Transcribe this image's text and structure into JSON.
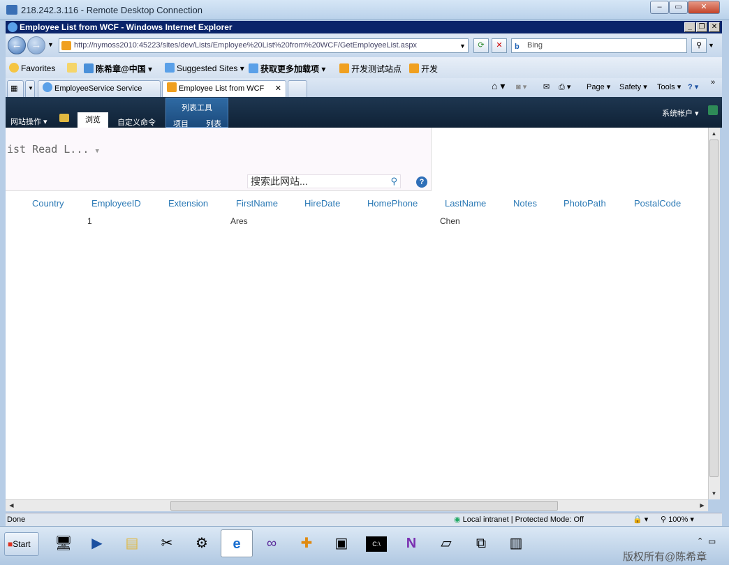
{
  "rdp": {
    "title": "218.242.3.116 - Remote Desktop Connection"
  },
  "ie": {
    "title": "Employee List from WCF - Windows Internet Explorer",
    "address": "http://nymoss2010:45223/sites/dev/Lists/Employee%20List%20from%20WCF/GetEmployeeList.aspx",
    "search_placeholder": "Bing",
    "favorites": {
      "label": "Favorites",
      "items": [
        "陈希章@中国",
        "Suggested Sites",
        "获取更多加载项",
        "开发测试站点",
        "开发"
      ]
    },
    "tabs": [
      "EmployeeService Service",
      "Employee List from WCF"
    ],
    "commands": {
      "page": "Page",
      "safety": "Safety",
      "tools": "Tools"
    }
  },
  "sharepoint": {
    "site_actions": "网站操作",
    "browse_tab": "浏览",
    "custom_commands": "自定义命令",
    "list_tools": "列表工具",
    "items_tab": "项目",
    "list_tab": "列表",
    "user": "系统帐户",
    "page_title": "ist Read L...",
    "search_placeholder": "搜索此网站...",
    "columns": [
      "Country",
      "EmployeeID",
      "Extension",
      "FirstName",
      "HireDate",
      "HomePhone",
      "LastName",
      "Notes",
      "PhotoPath",
      "PostalCode"
    ],
    "rows": [
      {
        "EmployeeID": "1",
        "FirstName": "Ares",
        "LastName": "Chen"
      }
    ]
  },
  "status": {
    "text": "Done",
    "zone": "Local intranet | Protected Mode: Off",
    "zoom": "100%"
  },
  "taskbar": {
    "start": "Start",
    "watermark": "版权所有@陈希章"
  }
}
